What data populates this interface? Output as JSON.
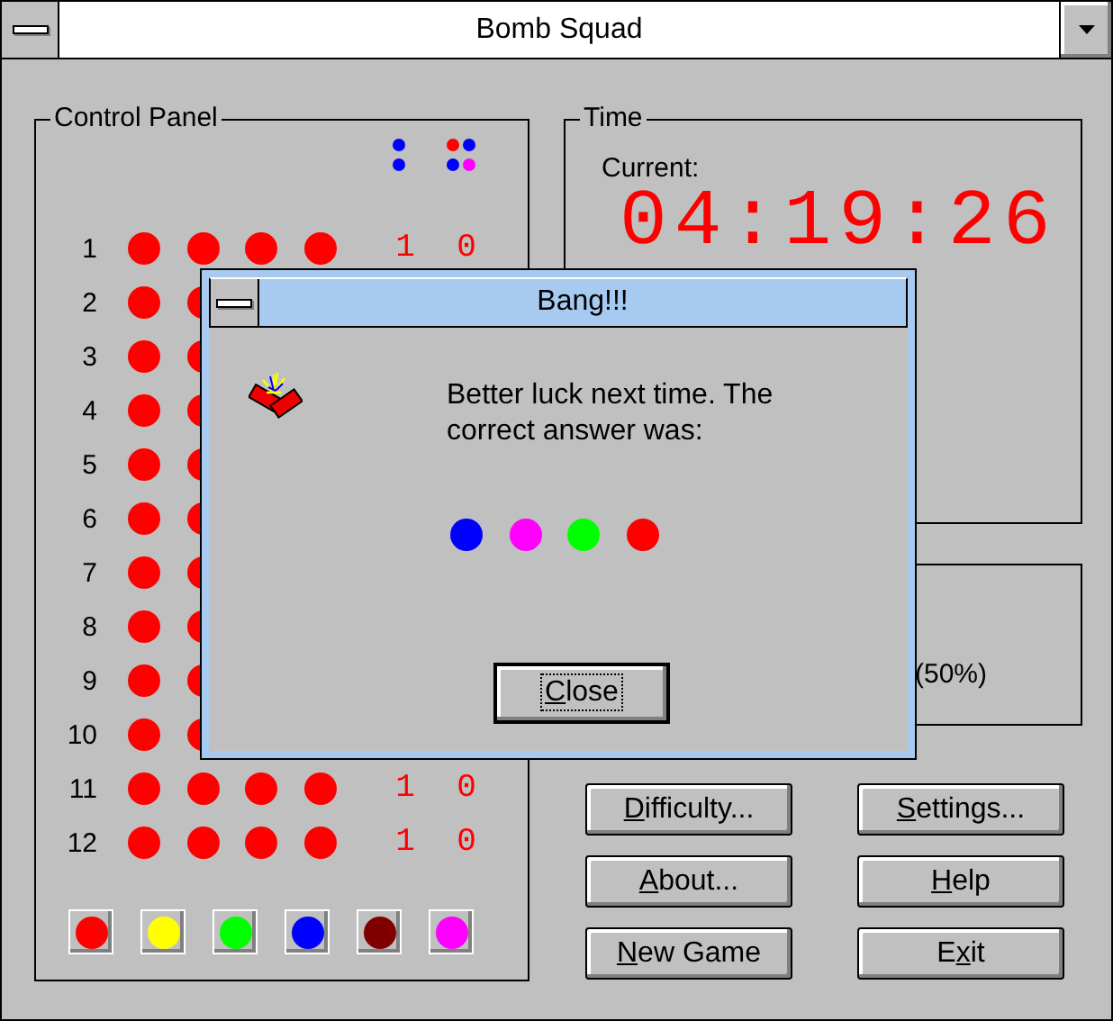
{
  "window": {
    "title": "Bomb Squad"
  },
  "control_panel": {
    "title": "Control Panel",
    "hint_groups": [
      {
        "kind": "column",
        "dots": [
          {
            "color": "#0000ff"
          },
          {
            "color": "#0000ff"
          }
        ]
      },
      {
        "kind": "grid",
        "dots": [
          {
            "color": "#ff0000"
          },
          {
            "color": "#0000ff"
          },
          {
            "color": "#0000ff"
          },
          {
            "color": "#ff00ff"
          }
        ]
      }
    ],
    "rows": [
      {
        "number": "1",
        "pegs": [
          {
            "color": "#ff0000"
          },
          {
            "color": "#ff0000"
          },
          {
            "color": "#ff0000"
          },
          {
            "color": "#ff0000"
          }
        ],
        "score": [
          "1",
          "0"
        ]
      },
      {
        "number": "2",
        "pegs": [
          {
            "color": "#ff0000"
          },
          {
            "color": "#ff0000"
          }
        ]
      },
      {
        "number": "3",
        "pegs": [
          {
            "color": "#ff0000"
          },
          {
            "color": "#ff0000"
          }
        ]
      },
      {
        "number": "4",
        "pegs": [
          {
            "color": "#ff0000"
          },
          {
            "color": "#ff0000"
          }
        ]
      },
      {
        "number": "5",
        "pegs": [
          {
            "color": "#ff0000"
          },
          {
            "color": "#ff0000"
          }
        ]
      },
      {
        "number": "6",
        "pegs": [
          {
            "color": "#ff0000"
          },
          {
            "color": "#ff0000"
          }
        ]
      },
      {
        "number": "7",
        "pegs": [
          {
            "color": "#ff0000"
          },
          {
            "color": "#ff0000"
          }
        ]
      },
      {
        "number": "8",
        "pegs": [
          {
            "color": "#ff0000"
          },
          {
            "color": "#ff0000"
          }
        ]
      },
      {
        "number": "9",
        "pegs": [
          {
            "color": "#ff0000"
          },
          {
            "color": "#ff0000"
          }
        ]
      },
      {
        "number": "10",
        "pegs": [
          {
            "color": "#ff0000"
          },
          {
            "color": "#ff0000"
          }
        ]
      },
      {
        "number": "11",
        "pegs": [
          {
            "color": "#ff0000"
          },
          {
            "color": "#ff0000"
          },
          {
            "color": "#ff0000"
          },
          {
            "color": "#ff0000"
          }
        ],
        "score": [
          "1",
          "0"
        ]
      },
      {
        "number": "12",
        "pegs": [
          {
            "color": "#ff0000"
          },
          {
            "color": "#ff0000"
          },
          {
            "color": "#ff0000"
          },
          {
            "color": "#ff0000"
          }
        ],
        "score": [
          "1",
          "0"
        ]
      }
    ],
    "palette": [
      {
        "color": "#ff0000"
      },
      {
        "color": "#ffff00"
      },
      {
        "color": "#00ff00"
      },
      {
        "color": "#0000ff"
      },
      {
        "color": "#800000"
      },
      {
        "color": "#ff00ff"
      }
    ]
  },
  "time": {
    "title": "Time",
    "current_label": "Current:",
    "current": "04:19:26"
  },
  "stats": {
    "text": "(50%)"
  },
  "buttons": [
    {
      "key": "D",
      "after": "ifficulty..."
    },
    {
      "key": "S",
      "after": "ettings..."
    },
    {
      "key": "A",
      "after": "bout..."
    },
    {
      "key": "H",
      "after": "elp"
    },
    {
      "key": "N",
      "after": "ew Game"
    },
    {
      "before": "E",
      "key": "x",
      "after": "it"
    }
  ],
  "dialog": {
    "title": "Bang!!!",
    "message": "Better luck next time.  The correct answer was:",
    "answer": [
      {
        "color": "#0000ff"
      },
      {
        "color": "#ff00ff"
      },
      {
        "color": "#00ff00"
      },
      {
        "color": "#ff0000"
      }
    ],
    "button": {
      "key": "C",
      "after": "lose"
    }
  }
}
